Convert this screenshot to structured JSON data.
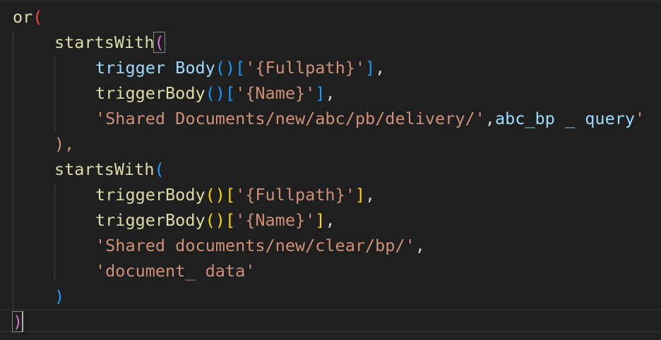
{
  "editor": {
    "lines": {
      "l1": {
        "fn": "or",
        "open": "("
      },
      "l2": {
        "fn": "startsWith",
        "open": "("
      },
      "l3": {
        "fn": "trigger Body",
        "call": "()",
        "bopen": "[",
        "str": "'{Fullpath}'",
        "bclose": "]",
        "comma": ","
      },
      "l4": {
        "fn": "triggerBody",
        "call": "()",
        "bopen": "[",
        "str": "'{Name}'",
        "bclose": "]",
        "comma": ","
      },
      "l5": {
        "str": "'Shared Documents/new/abc/pb/delivery/'",
        "comma": ",",
        "var": "abc_bp _ query",
        "str2": "'"
      },
      "l6": {
        "close": ")",
        "comma": ","
      },
      "l7": {
        "fn": "startsWith",
        "open": "("
      },
      "l8": {
        "fn": "triggerBody",
        "call": "()",
        "bopen": "[",
        "str": "'{Fullpath}'",
        "bclose": "]",
        "comma": ","
      },
      "l9": {
        "fn": "triggerBody",
        "call": "()",
        "bopen": "[",
        "str": "'{Name}'",
        "bclose": "]",
        "comma": ","
      },
      "l10": {
        "str": "'Shared documents/new/clear/bp/'",
        "comma": ","
      },
      "l11": {
        "str": "'document_ data'"
      },
      "l12": {
        "close": ")"
      },
      "l13": {
        "close": ")"
      }
    }
  }
}
